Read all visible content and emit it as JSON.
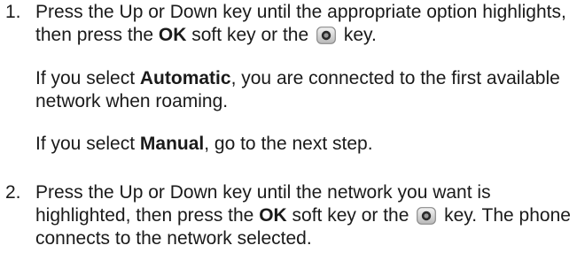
{
  "steps": [
    {
      "number": "1.",
      "main": {
        "pre": "Press the Up or Down key until the appropriate option highlights, then press the ",
        "bold": "OK",
        "mid": " soft key or the ",
        "icon": "ok-key-icon",
        "post": " key."
      },
      "notes": [
        {
          "pre": "If you select ",
          "bold": "Automatic",
          "post": ", you are connected to the first available network when roaming."
        },
        {
          "pre": "If you select ",
          "bold": "Manual",
          "post": ", go to the next step."
        }
      ]
    },
    {
      "number": "2.",
      "main": {
        "pre": "Press the Up or Down key until the network you want is highlighted, then press the ",
        "bold": "OK",
        "mid": " soft key or the ",
        "icon": "ok-key-icon",
        "post": " key. The phone connects to the network selected."
      }
    }
  ]
}
